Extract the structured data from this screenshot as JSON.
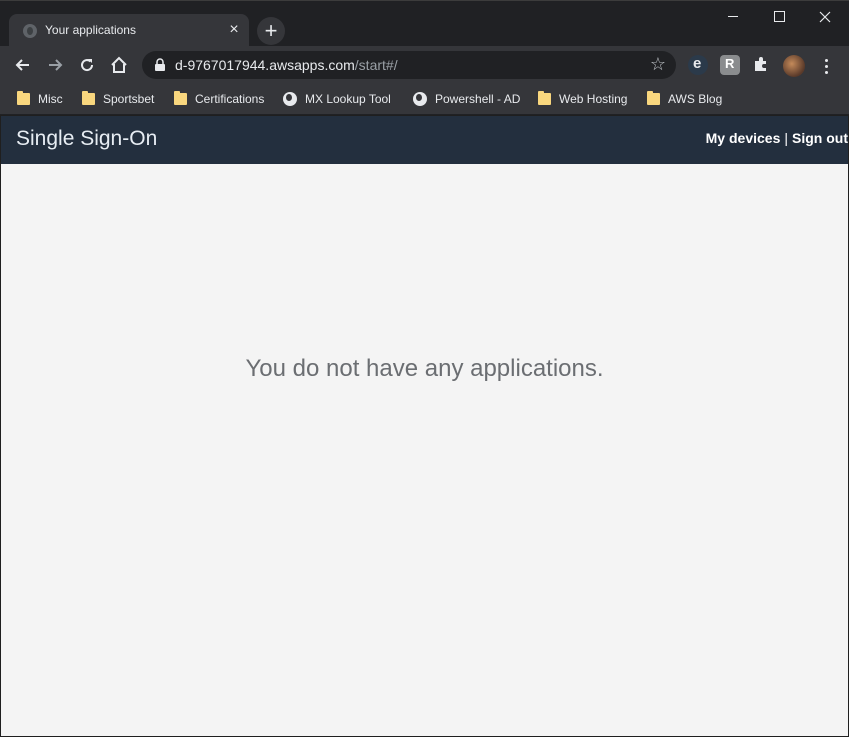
{
  "browser": {
    "tab": {
      "title": "Your applications",
      "close_glyph": "×"
    },
    "new_tab_glyph": "+",
    "url": {
      "host": "d-9767017944.awsapps.com",
      "path": "/start#/"
    },
    "star_glyph": "☆",
    "bookmarks": [
      {
        "label": "Misc",
        "icon": "folder-icon"
      },
      {
        "label": "Sportsbet",
        "icon": "folder-icon"
      },
      {
        "label": "Certifications",
        "icon": "folder-icon"
      },
      {
        "label": "MX Lookup Tool",
        "icon": "globe-icon"
      },
      {
        "label": "Powershell - AD",
        "icon": "globe-icon"
      },
      {
        "label": "Web Hosting",
        "icon": "folder-icon"
      },
      {
        "label": "AWS Blog",
        "icon": "folder-icon"
      }
    ]
  },
  "page": {
    "brand": "Single Sign-On",
    "links": {
      "devices": "My devices",
      "separator": "|",
      "signout": "Sign out"
    },
    "empty_message": "You do not have any applications."
  },
  "colors": {
    "header_bg": "#232f3e",
    "page_bg": "#f4f4f4",
    "chrome_dark": "#202124",
    "chrome_toolbar": "#35363a"
  }
}
